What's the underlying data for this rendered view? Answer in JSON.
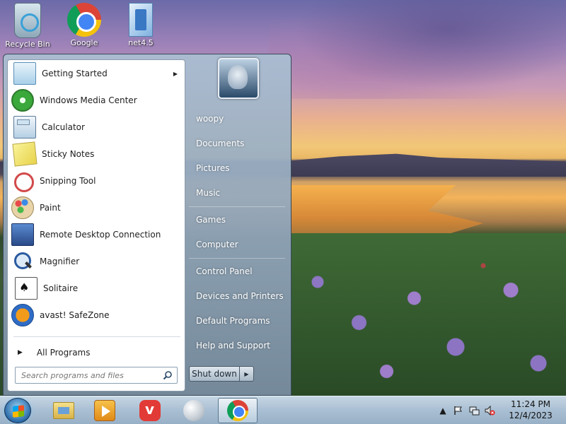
{
  "desktop": {
    "icons": [
      {
        "label": "Recycle Bin",
        "icon": "recycle-bin-icon"
      },
      {
        "label": "Google",
        "icon": "chrome-icon"
      },
      {
        "label": "net4.5",
        "icon": "file-icon"
      }
    ]
  },
  "start_menu": {
    "programs": [
      {
        "label": "Getting Started",
        "icon": "getting-started-icon",
        "has_submenu": true
      },
      {
        "label": "Windows Media Center",
        "icon": "media-center-icon"
      },
      {
        "label": "Calculator",
        "icon": "calculator-icon"
      },
      {
        "label": "Sticky Notes",
        "icon": "sticky-notes-icon"
      },
      {
        "label": "Snipping Tool",
        "icon": "snipping-tool-icon"
      },
      {
        "label": "Paint",
        "icon": "paint-icon"
      },
      {
        "label": "Remote Desktop Connection",
        "icon": "remote-desktop-icon"
      },
      {
        "label": "Magnifier",
        "icon": "magnifier-icon"
      },
      {
        "label": "Solitaire",
        "icon": "solitaire-icon"
      },
      {
        "label": "avast! SafeZone",
        "icon": "avast-icon"
      }
    ],
    "all_programs": "All Programs",
    "search_placeholder": "Search programs and files",
    "user_name": "woopy",
    "right_items": {
      "documents": "Documents",
      "pictures": "Pictures",
      "music": "Music",
      "games": "Games",
      "computer": "Computer",
      "control_panel": "Control Panel",
      "devices": "Devices and Printers",
      "default_programs": "Default Programs",
      "help": "Help and Support"
    },
    "shutdown_label": "Shut down"
  },
  "taskbar": {
    "pinned": [
      "explorer-icon",
      "media-player-icon",
      "vivaldi-icon",
      "ball-icon",
      "chrome-icon"
    ],
    "active": "chrome-icon",
    "clock_time": "11:24 PM",
    "clock_date": "12/4/2023"
  }
}
